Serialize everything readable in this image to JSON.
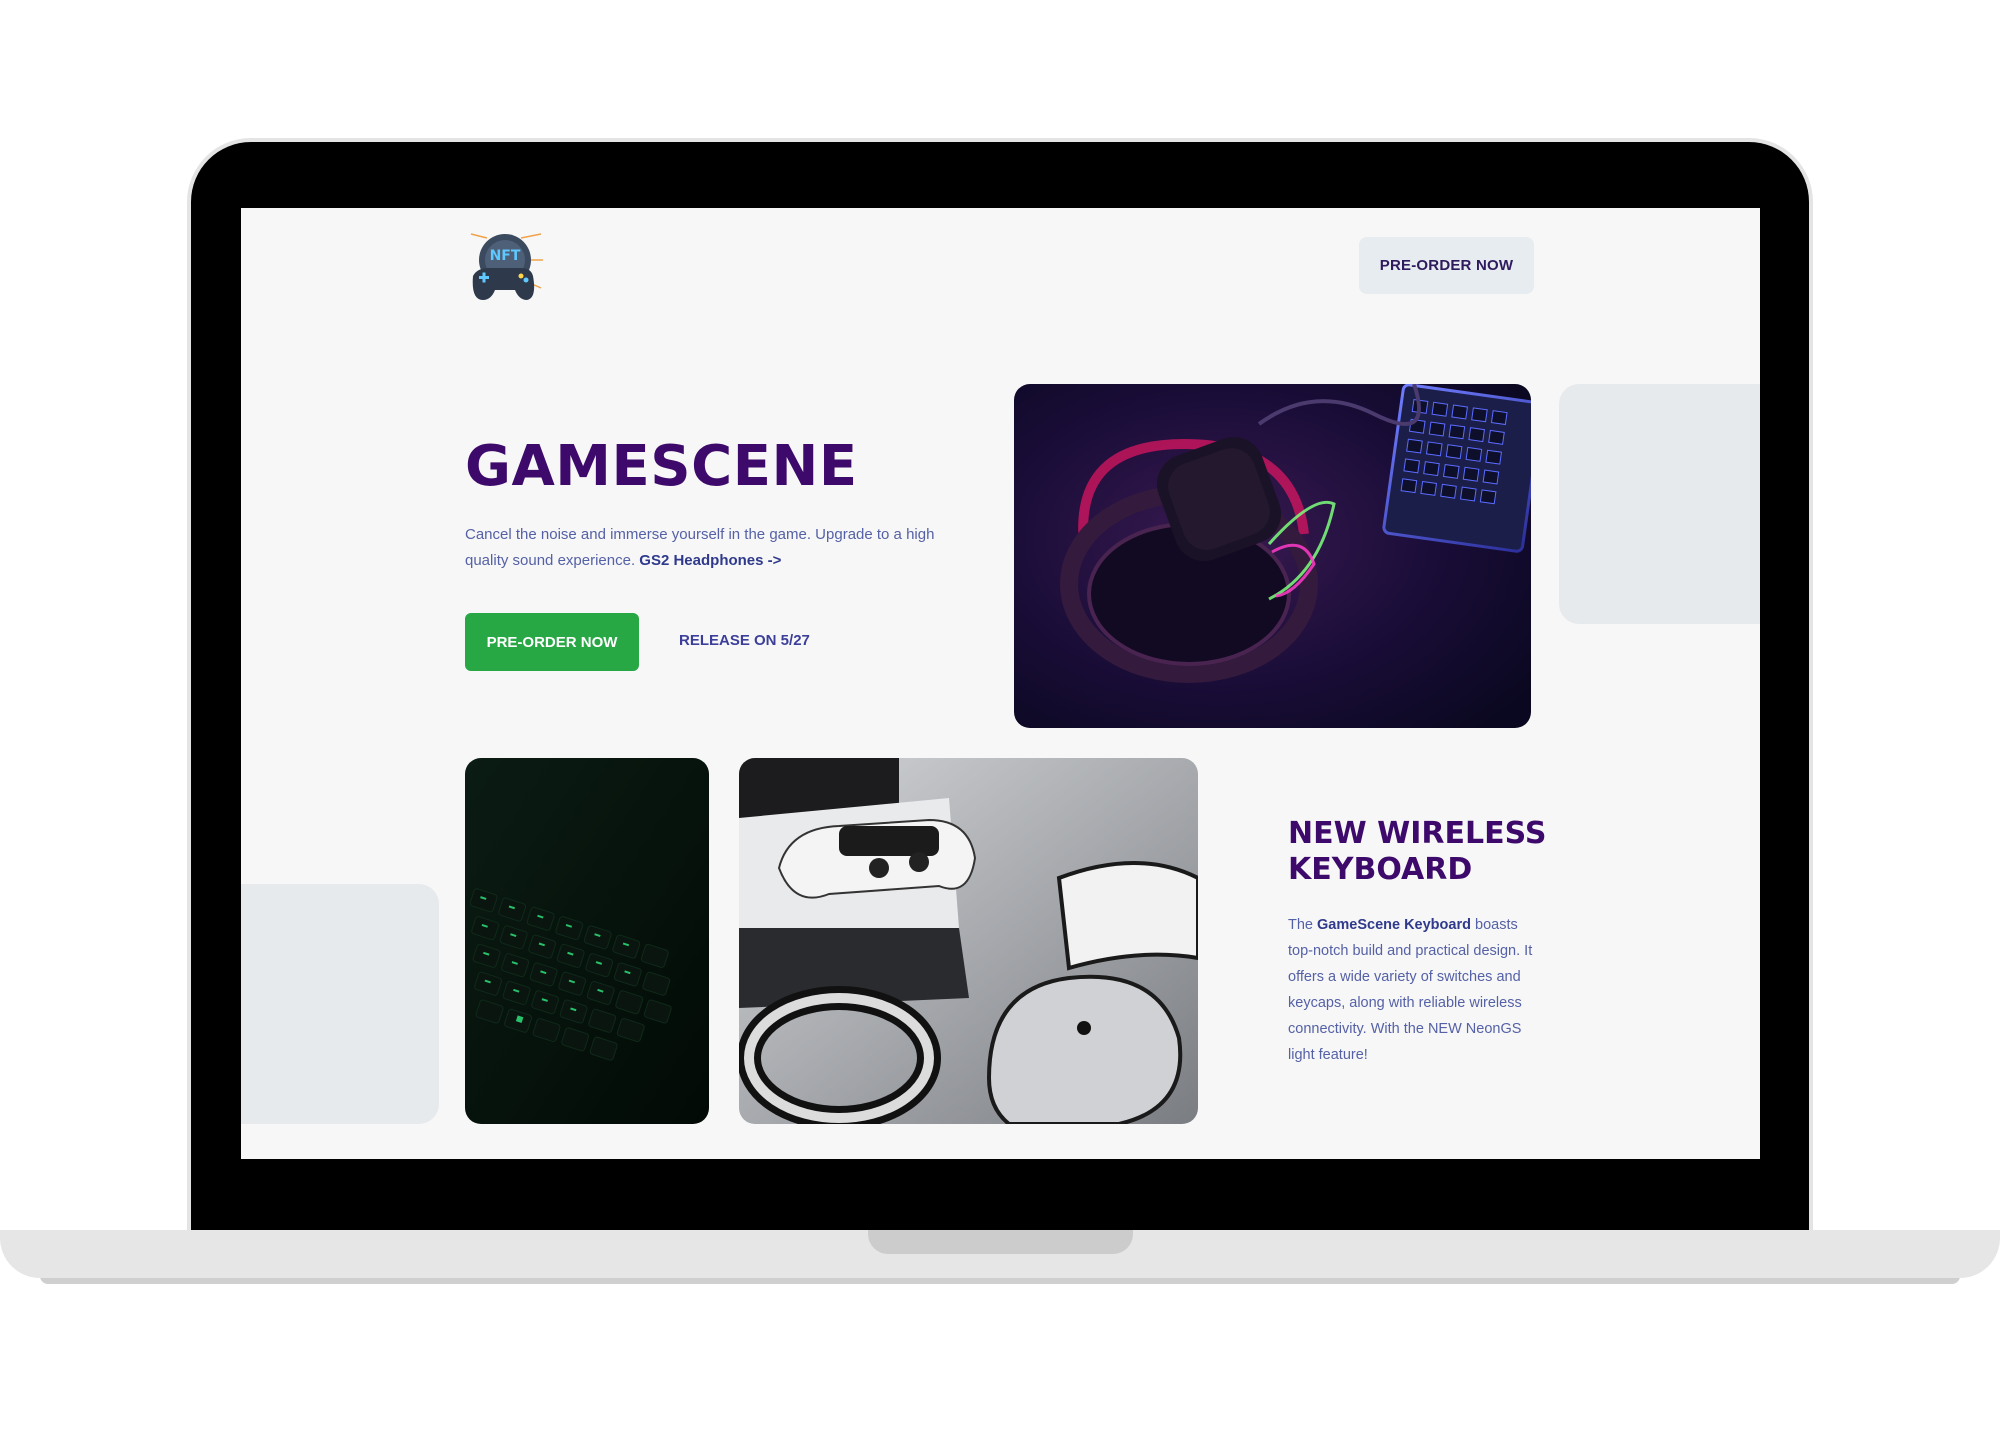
{
  "nav": {
    "logo_text": "NFT",
    "cta_label": "PRE-ORDER NOW"
  },
  "hero": {
    "title": "GAMESCENE",
    "description": "Cancel the noise and immerse yourself in the game. Upgrade to a high quality sound experience.",
    "link_label": "GS2 Headphones ->",
    "primary_button": "PRE-ORDER NOW",
    "release_label": "RELEASE ON 5/27"
  },
  "feature": {
    "title": "NEW WIRELESS KEYBOARD",
    "text_before": "The",
    "product_name": "GameScene Keyboard",
    "text_after": "boasts top-notch build and practical design. It offers a wide variety of switches and keycaps, along with reliable wireless connectivity. With the NEW NeonGS light feature!"
  },
  "colors": {
    "brand_purple": "#3d0a6b",
    "body_text": "#5561a6",
    "primary_green": "#28a745",
    "screen_bg": "#f7f7f7"
  },
  "icons": [
    "gamepad-logo-icon"
  ]
}
